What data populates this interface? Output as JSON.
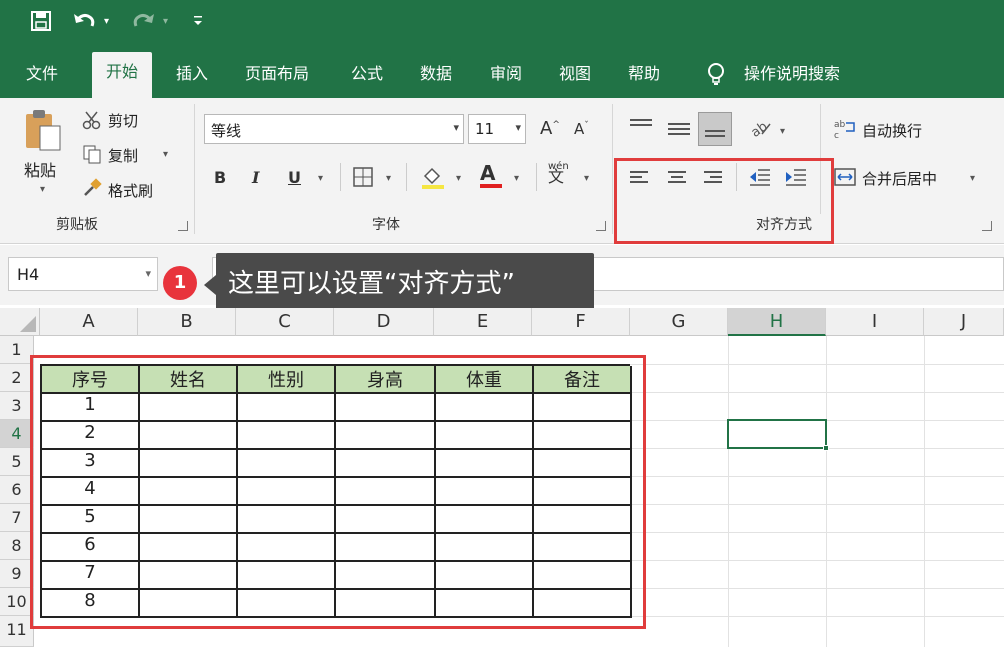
{
  "quick_access": {
    "save_icon": "save-icon",
    "undo_icon": "undo-icon",
    "redo_icon": "redo-icon",
    "customize_icon": "customize-icon"
  },
  "tabs": [
    "文件",
    "开始",
    "插入",
    "页面布局",
    "公式",
    "数据",
    "审阅",
    "视图",
    "帮助"
  ],
  "tell_me": "操作说明搜索",
  "clipboard": {
    "paste": "粘贴",
    "cut": "剪切",
    "copy": "复制",
    "format_painter": "格式刷",
    "group_label": "剪贴板"
  },
  "font": {
    "name": "等线",
    "size": "11",
    "bold": "B",
    "italic": "I",
    "underline": "U",
    "group_label": "字体",
    "grow": "A",
    "shrink": "A",
    "font_color_letter": "A",
    "phonetic": "wén"
  },
  "alignment": {
    "wrap_text": "自动换行",
    "merge_center": "合并后居中",
    "group_label": "对齐方式"
  },
  "name_box": "H4",
  "callout": {
    "badge": "1",
    "text": "这里可以设置“对齐方式”"
  },
  "columns": [
    "A",
    "B",
    "C",
    "D",
    "E",
    "F",
    "G",
    "H",
    "I",
    "J"
  ],
  "rows": [
    "1",
    "2",
    "3",
    "4",
    "5",
    "6",
    "7",
    "8",
    "9",
    "10",
    "11"
  ],
  "table": {
    "headers": [
      "序号",
      "姓名",
      "性别",
      "身高",
      "体重",
      "备注"
    ],
    "rows": [
      [
        "1"
      ],
      [
        "2"
      ],
      [
        "3"
      ],
      [
        "4"
      ],
      [
        "5"
      ],
      [
        "6"
      ],
      [
        "7"
      ],
      [
        "8"
      ]
    ]
  },
  "colors": {
    "excel_green": "#217346",
    "header_fill": "#c6e0b4",
    "highlight_red": "#e03c3c"
  }
}
